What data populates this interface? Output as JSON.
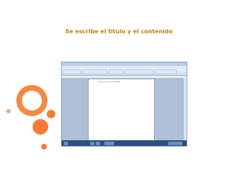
{
  "slide": {
    "title": "Se escribe el titulo y el contenido"
  },
  "word_window": {
    "page_text": "Escribe el titulo y el contenido"
  },
  "colors": {
    "title": "#b8860b",
    "accent_orange": "#f47c35",
    "ribbon_blue": "#c9daef"
  },
  "icons": [
    "word-window-screenshot"
  ]
}
